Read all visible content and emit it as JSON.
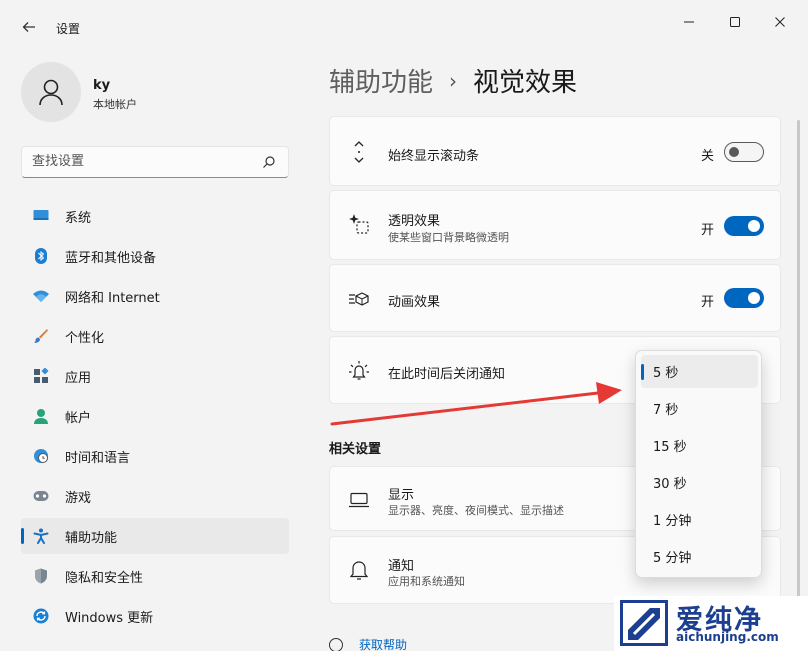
{
  "window": {
    "title": "设置",
    "back_icon": "back-arrow-icon",
    "minimize_icon": "minimize-icon",
    "maximize_icon": "maximize-icon",
    "close_icon": "close-icon"
  },
  "user": {
    "name": "ky",
    "account_type": "本地帐户",
    "avatar_icon": "person-icon"
  },
  "search": {
    "placeholder": "查找设置",
    "icon": "search-icon"
  },
  "sidebar": {
    "items": [
      {
        "label": "系统",
        "icon": "monitor-icon",
        "active": false
      },
      {
        "label": "蓝牙和其他设备",
        "icon": "bluetooth-icon",
        "active": false
      },
      {
        "label": "网络和 Internet",
        "icon": "wifi-icon",
        "active": false
      },
      {
        "label": "个性化",
        "icon": "brush-icon",
        "active": false
      },
      {
        "label": "应用",
        "icon": "apps-icon",
        "active": false
      },
      {
        "label": "帐户",
        "icon": "account-icon",
        "active": false
      },
      {
        "label": "时间和语言",
        "icon": "globe-clock-icon",
        "active": false
      },
      {
        "label": "游戏",
        "icon": "gamepad-icon",
        "active": false
      },
      {
        "label": "辅助功能",
        "icon": "accessibility-icon",
        "active": true
      },
      {
        "label": "隐私和安全性",
        "icon": "shield-icon",
        "active": false
      },
      {
        "label": "Windows 更新",
        "icon": "update-icon",
        "active": false
      }
    ]
  },
  "breadcrumb": {
    "parent": "辅助功能",
    "separator": "›",
    "current": "视觉效果"
  },
  "settings": {
    "scrollbars": {
      "title": "始终显示滚动条",
      "state_label": "关",
      "on": false,
      "icon": "scroll-arrows-icon"
    },
    "transparency": {
      "title": "透明效果",
      "subtitle": "使某些窗口背景略微透明",
      "state_label": "开",
      "on": true,
      "icon": "sparkle-icon"
    },
    "animation": {
      "title": "动画效果",
      "state_label": "开",
      "on": true,
      "icon": "animation-icon"
    },
    "notification_timeout": {
      "title": "在此时间后关闭通知",
      "icon": "bell-sun-icon"
    }
  },
  "related": {
    "title": "相关设置",
    "items": [
      {
        "title": "显示",
        "subtitle": "显示器、亮度、夜间模式、显示描述",
        "icon": "display-icon"
      },
      {
        "title": "通知",
        "subtitle": "应用和系统通知",
        "icon": "bell-icon"
      }
    ]
  },
  "help": {
    "label": "获取帮助"
  },
  "dropdown": {
    "options": [
      "5 秒",
      "7 秒",
      "15 秒",
      "30 秒",
      "1 分钟",
      "5 分钟"
    ],
    "selected": "5 秒"
  },
  "watermark": {
    "text": "爱纯净",
    "url": "aichunjing.com"
  },
  "colors": {
    "accent": "#0067c0",
    "arrow": "#e53935",
    "watermark": "#1c3f8f"
  }
}
